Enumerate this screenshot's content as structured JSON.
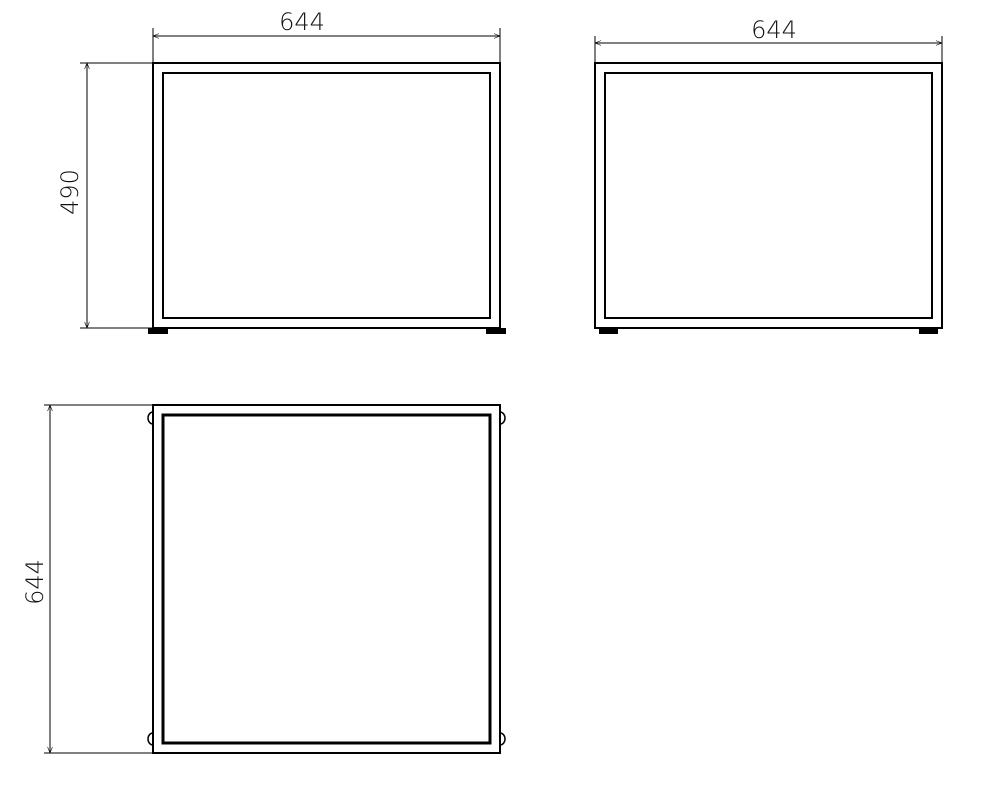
{
  "views": {
    "front": {
      "width_label": "644",
      "height_label": "490"
    },
    "side": {
      "width_label": "644"
    },
    "top": {
      "depth_label": "644"
    }
  },
  "colors": {
    "line": "#000000",
    "background": "#ffffff"
  }
}
